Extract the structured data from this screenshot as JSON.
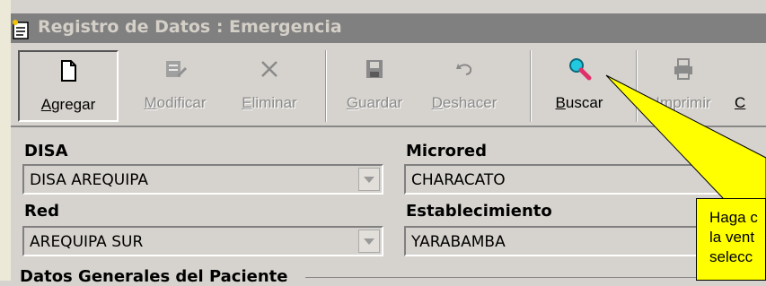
{
  "window": {
    "title": "Registro de Datos : Emergencia"
  },
  "toolbar": {
    "buttons": [
      {
        "label": "Agregar",
        "enabled": true,
        "icon": "new-document-icon"
      },
      {
        "label": "Modificar",
        "enabled": false,
        "icon": "edit-icon"
      },
      {
        "label": "Eliminar",
        "enabled": false,
        "icon": "delete-x-icon"
      },
      {
        "label": "Guardar",
        "enabled": false,
        "icon": "floppy-disk-icon"
      },
      {
        "label": "Deshacer",
        "enabled": false,
        "icon": "undo-icon"
      },
      {
        "label": "Buscar",
        "enabled": true,
        "icon": "magnifier-icon"
      },
      {
        "label": "Imprimir",
        "enabled": false,
        "icon": "printer-icon"
      },
      {
        "label": "C",
        "enabled": true,
        "icon": ""
      }
    ]
  },
  "form": {
    "disa": {
      "label": "DISA",
      "value": "DISA AREQUIPA"
    },
    "microred": {
      "label": "Microred",
      "value": "CHARACATO"
    },
    "red": {
      "label": "Red",
      "value": "AREQUIPA SUR"
    },
    "establecimiento": {
      "label": "Establecimiento",
      "value": "YARABAMBA"
    },
    "group_title": "Datos Generales del Paciente"
  },
  "callout": {
    "lines": [
      "Haga c",
      "la vent",
      "selecc"
    ]
  },
  "colors": {
    "callout": "#ffff00",
    "title_bar": "#808080",
    "magnifier": "#e0306a"
  }
}
